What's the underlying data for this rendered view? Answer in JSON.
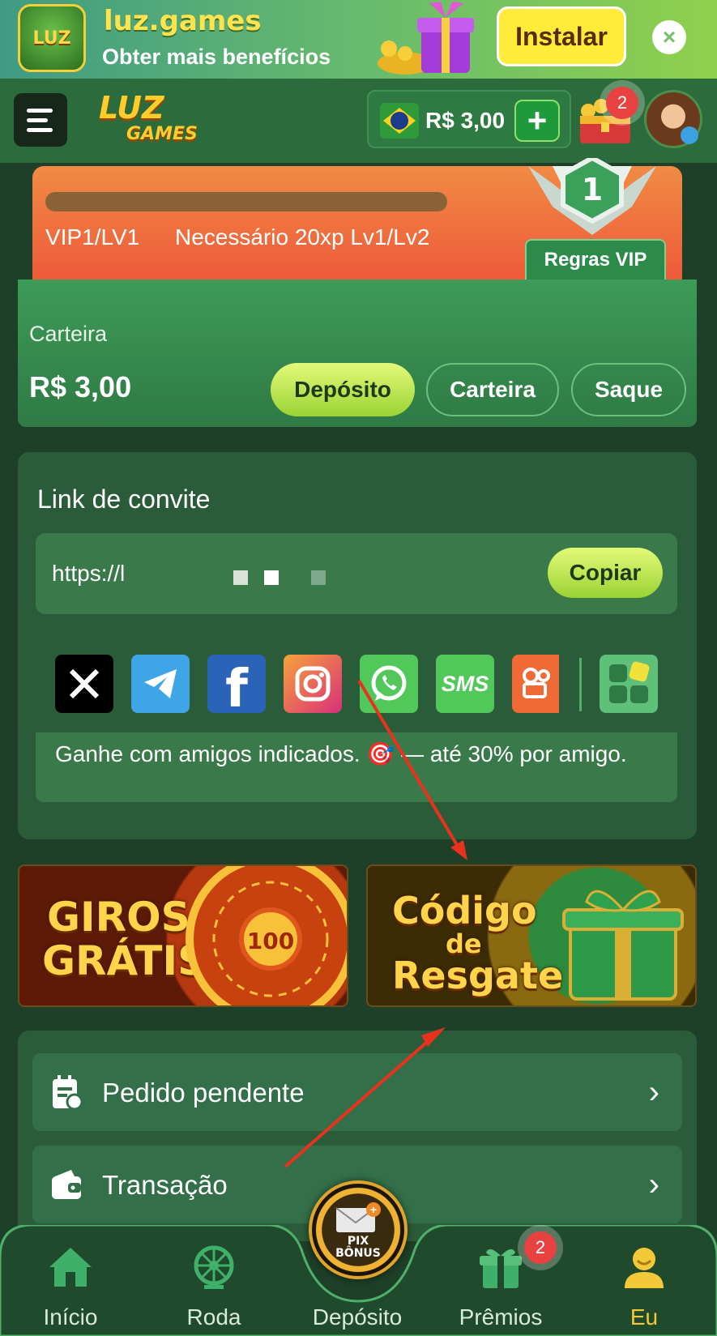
{
  "banner": {
    "app_name": "luz.games",
    "subtitle": "Obter mais benefícios",
    "install_label": "Instalar",
    "close_icon": "×",
    "app_icon_text": "LUZ"
  },
  "header": {
    "logo_line1": "LUZ",
    "logo_line2": "GAMES",
    "balance": "R$ 3,00",
    "plus_label": "+",
    "chest_badge": "2"
  },
  "vip": {
    "progress": 0.0,
    "level": "VIP1/LV1",
    "requirement": "Necessário 20xp Lv1/Lv2",
    "medal_number": "1",
    "rules_label": "Regras VIP"
  },
  "wallet": {
    "label": "Carteira",
    "amount": "R$ 3,00",
    "deposit_label": "Depósito",
    "wallet_label": "Carteira",
    "withdraw_label": "Saque"
  },
  "invite": {
    "title": "Link de convite",
    "link": "https://l",
    "copy_label": "Copiar",
    "social": [
      {
        "name": "x-icon",
        "glyph": "X",
        "bg": "#000000"
      },
      {
        "name": "telegram-icon",
        "glyph": "➤",
        "bg": "#3ea6e6"
      },
      {
        "name": "facebook-icon",
        "glyph": "f",
        "bg": "#2a63b8"
      },
      {
        "name": "instagram-icon",
        "glyph": "◎",
        "bg": "#e0405e"
      },
      {
        "name": "whatsapp-icon",
        "glyph": "✆",
        "bg": "#53c85a"
      },
      {
        "name": "sms-icon",
        "glyph": "SMS",
        "bg": "#53c85a"
      },
      {
        "name": "kwai-icon",
        "glyph": "▶",
        "bg": "#f06a35"
      },
      {
        "name": "more-apps-icon",
        "glyph": "",
        "bg": "#5fc07a"
      }
    ],
    "earn_text": "Ganhe com amigos indicados. 🎯 — até 30% por amigo."
  },
  "promos": {
    "giros_line1": "GIROS",
    "giros_line2": "GRÁTIS",
    "wheel_center": "100",
    "codigo_line1": "Código",
    "codigo_line2": "de",
    "codigo_line3": "Resgate"
  },
  "menu": {
    "items": [
      {
        "label": "Pedido pendente",
        "icon": "pending-order-icon"
      },
      {
        "label": "Transação",
        "icon": "wallet-icon"
      }
    ]
  },
  "bottom_nav": {
    "items": [
      {
        "label": "Início",
        "icon": "home-icon"
      },
      {
        "label": "Roda",
        "icon": "wheel-icon"
      },
      {
        "label": "Depósito",
        "icon": "pix-bonus-icon"
      },
      {
        "label": "Prêmios",
        "icon": "gift-icon"
      },
      {
        "label": "Eu",
        "icon": "user-icon"
      }
    ],
    "center_text": "PIX BÔNUS",
    "premios_badge": "2",
    "active": "Eu"
  },
  "colors": {
    "accent_green": "#9ad333",
    "active_nav": "#f3c93a",
    "badge_red": "#e84142",
    "arrow_red": "#e8321e"
  }
}
